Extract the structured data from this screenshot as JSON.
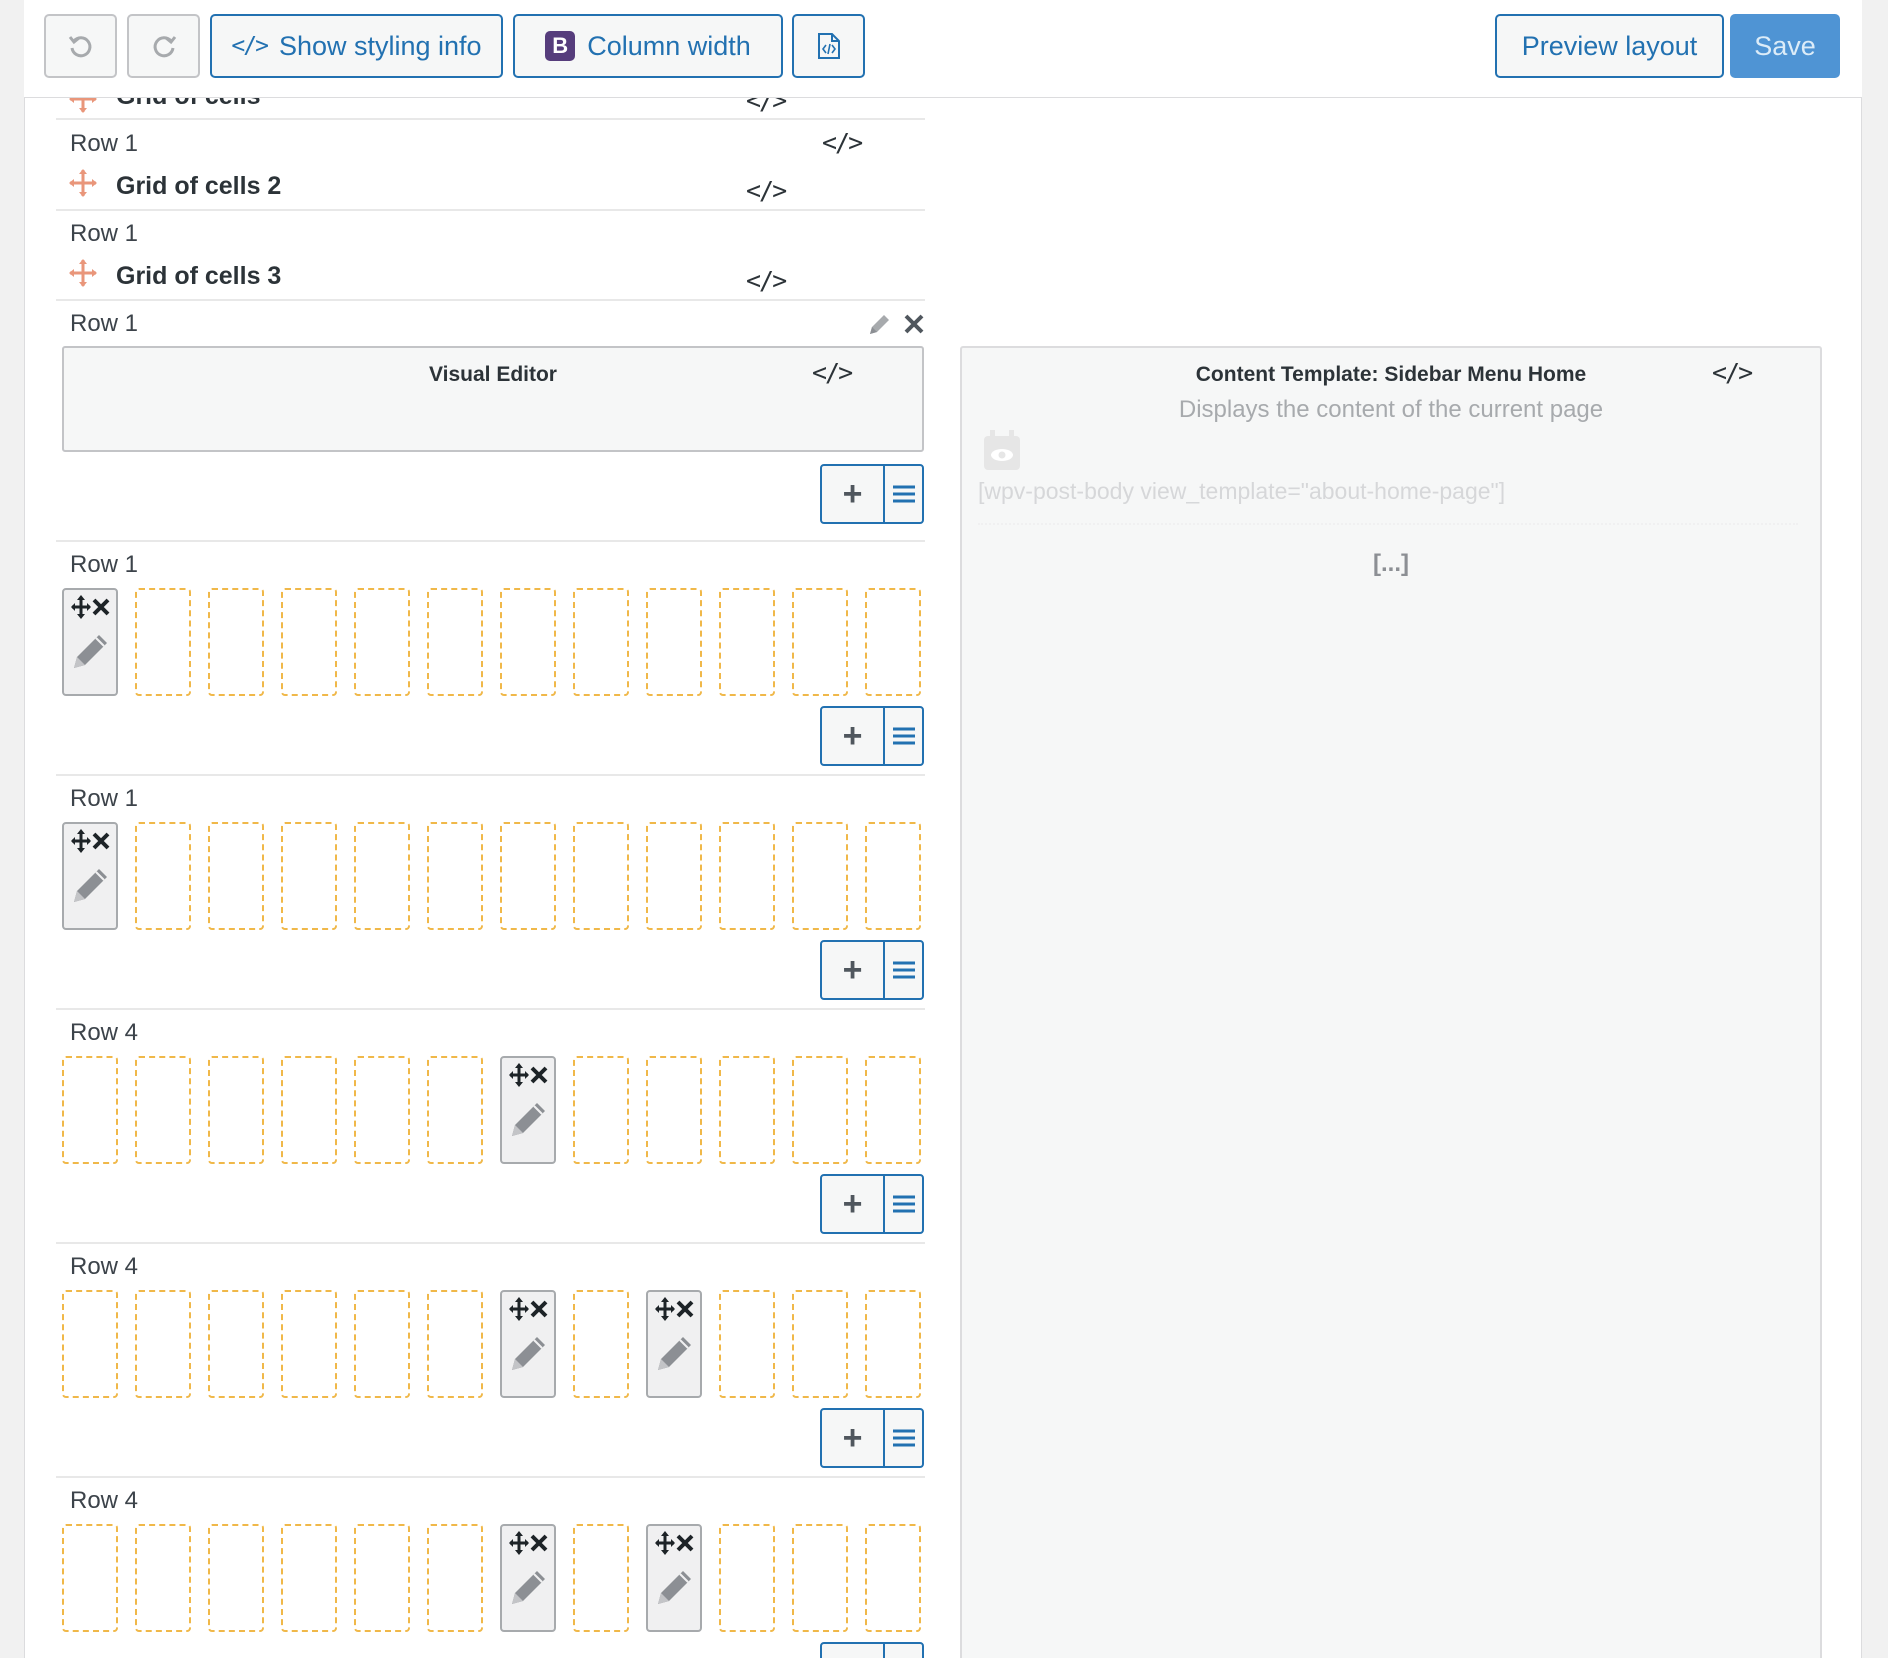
{
  "toolbar": {
    "undo_icon": "undo-icon",
    "redo_icon": "redo-icon",
    "styling_label": "Show styling info",
    "column_width_label": "Column width",
    "bootstrap_letter": "B",
    "preview_label": "Preview layout",
    "save_label": "Save"
  },
  "top_partial": {
    "title": "Grid of cells"
  },
  "grid_items": [
    {
      "row_label": "Row 1",
      "title": "Grid of cells 2"
    },
    {
      "row_label": "Row 1",
      "title": "Grid of cells 3"
    }
  ],
  "editor_row": {
    "row_label": "Row 1"
  },
  "visual_editor": {
    "title": "Visual Editor"
  },
  "content_template": {
    "title": "Content Template: Sidebar Menu Home",
    "subtitle": "Displays the content of the current page",
    "shortcode": "[wpv-post-body view_template=\"about-home-page\"]",
    "more": "[...]"
  },
  "rows": [
    {
      "label": "Row 1",
      "filled": [
        0
      ]
    },
    {
      "label": "Row 1",
      "filled": [
        0
      ]
    },
    {
      "label": "Row 4",
      "filled": [
        6
      ]
    },
    {
      "label": "Row 4",
      "filled": [
        6,
        8
      ]
    },
    {
      "label": "Row 4",
      "filled": [
        6,
        8
      ]
    }
  ],
  "colors": {
    "accent": "#2271b1",
    "cell_border": "#f0b849",
    "move_icon": "#e9967a",
    "bootstrap": "#563d7c"
  }
}
